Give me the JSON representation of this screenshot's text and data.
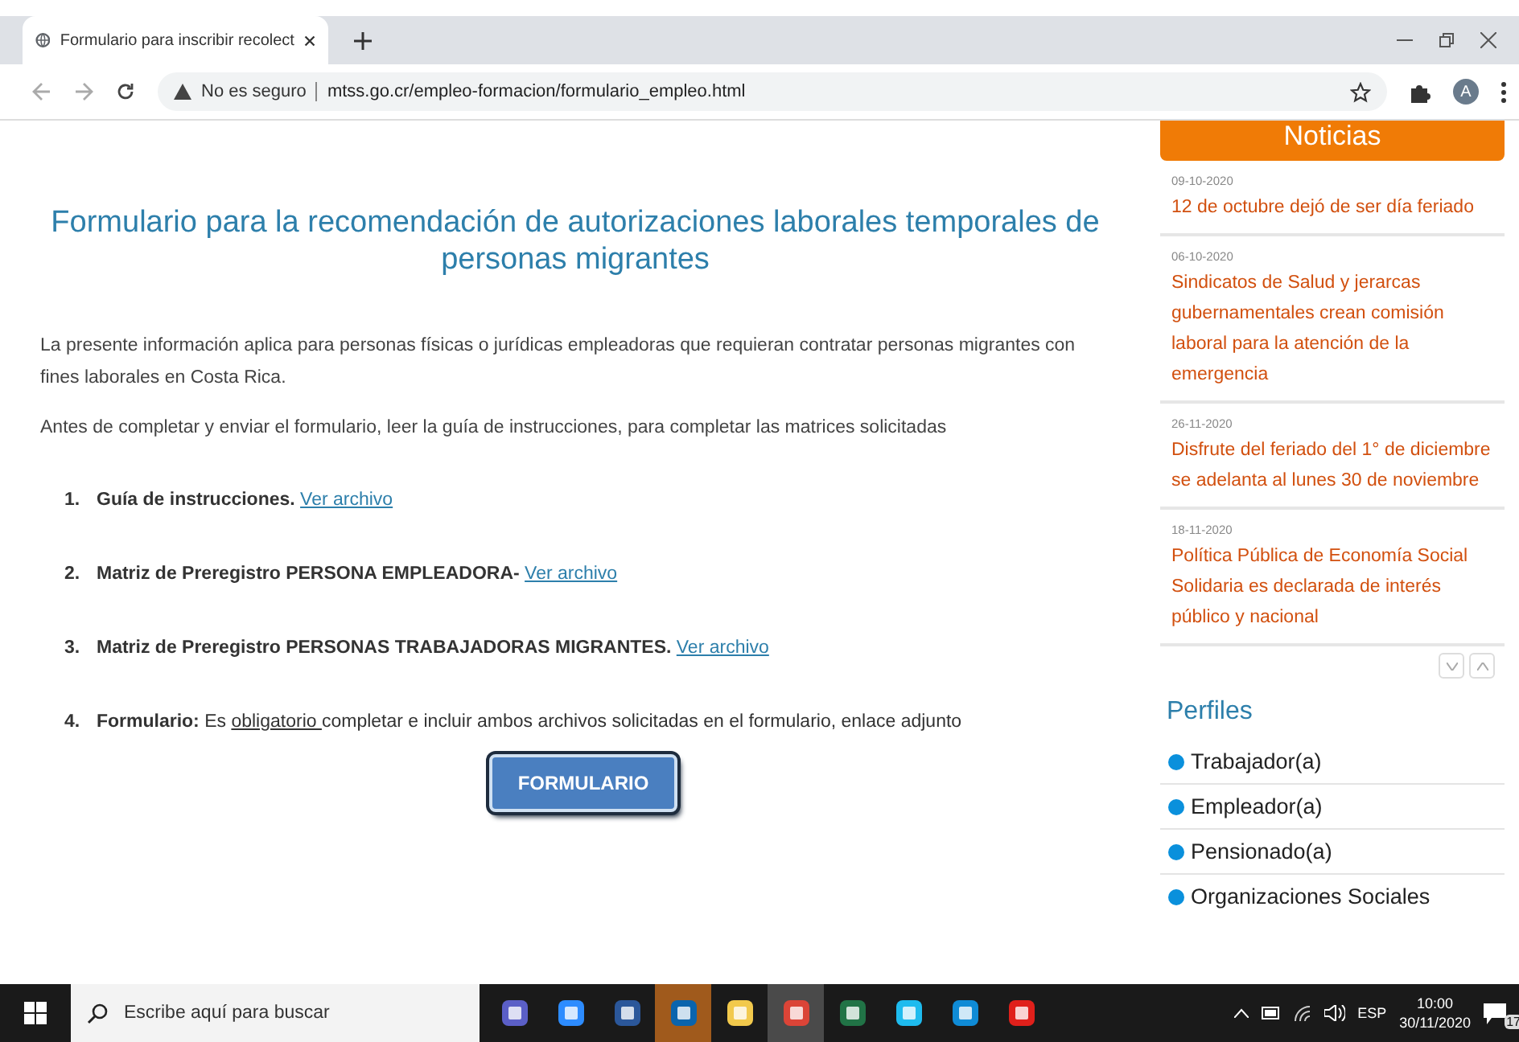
{
  "browser": {
    "tab_title": "Formulario para inscribir recolect",
    "security": "No es seguro",
    "url": "mtss.go.cr/empleo-formacion/formulario_empleo.html",
    "avatar": "A"
  },
  "page": {
    "title": "Formulario para la recomendación de autorizaciones laborales temporales de personas migrantes",
    "paragraphs": [
      "La presente información aplica para personas físicas o jurídicas empleadoras que requieran contratar personas migrantes con fines laborales en Costa Rica.",
      "Antes de completar y enviar el formulario, leer la guía de instrucciones, para completar las matrices solicitadas"
    ],
    "steps": [
      {
        "number": "1.",
        "parts": [
          {
            "kind": "bold",
            "text": "Guía de instrucciones. "
          },
          {
            "kind": "link",
            "text": "Ver archivo"
          }
        ]
      },
      {
        "number": "2.",
        "parts": [
          {
            "kind": "bold",
            "text": "Matriz de Preregistro PERSONA EMPLEADORA- "
          },
          {
            "kind": "link",
            "text": "Ver archivo"
          }
        ]
      },
      {
        "number": "3.",
        "parts": [
          {
            "kind": "bold",
            "text": "Matriz de Preregistro PERSONAS TRABAJADORAS MIGRANTES. "
          },
          {
            "kind": "link",
            "text": "Ver archivo"
          }
        ]
      },
      {
        "number": "4.",
        "parts": [
          {
            "kind": "bold",
            "text": "Formulario:"
          },
          {
            "kind": "plain",
            "text": " Es "
          },
          {
            "kind": "underline",
            "text": "obligatorio "
          },
          {
            "kind": "plain",
            "text": " completar e incluir ambos archivos solicitadas en el formulario, enlace adjunto"
          }
        ]
      }
    ],
    "button": "FORMULARIO"
  },
  "sidebar": {
    "news_heading": "Noticias",
    "news": [
      {
        "date": "09-10-2020",
        "title": "12 de octubre dejó de ser día feriado"
      },
      {
        "date": "06-10-2020",
        "title": "Sindicatos de Salud y jerarcas gubernamentales crean comisión laboral para la atención de la emergencia"
      },
      {
        "date": "26-11-2020",
        "title": "Disfrute del feriado del 1° de diciembre se adelanta al lunes 30 de noviembre"
      },
      {
        "date": "18-11-2020",
        "title": "Política Pública de Economía Social Solidaria es declarada de interés público y nacional"
      }
    ],
    "profiles_heading": "Perfiles",
    "profiles": [
      "Trabajador(a)",
      "Empleador(a)",
      "Pensionado(a)",
      "Organizaciones Sociales"
    ]
  },
  "taskbar": {
    "search_placeholder": "Escribe aquí para buscar",
    "apps": [
      {
        "kind": "teams",
        "selected": false,
        "flashing": false
      },
      {
        "kind": "zoom",
        "selected": false,
        "flashing": false
      },
      {
        "kind": "word",
        "selected": false,
        "flashing": false
      },
      {
        "kind": "outlook",
        "selected": false,
        "flashing": true
      },
      {
        "kind": "files",
        "selected": false,
        "flashing": false
      },
      {
        "kind": "chrome",
        "selected": true,
        "flashing": false
      },
      {
        "kind": "excel",
        "selected": false,
        "flashing": false
      },
      {
        "kind": "ie",
        "selected": false,
        "flashing": false
      },
      {
        "kind": "edge",
        "selected": false,
        "flashing": false
      },
      {
        "kind": "acrobat",
        "selected": false,
        "flashing": false
      }
    ],
    "language": "ESP",
    "time": "10:00",
    "date": "30/11/2020",
    "notifications": "17"
  }
}
